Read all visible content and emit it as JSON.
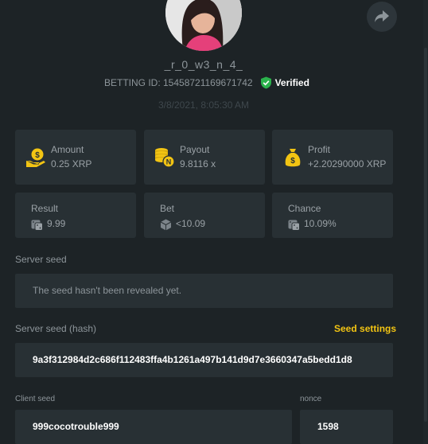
{
  "profile": {
    "username": "_r_0_w3_n_4_",
    "betting_id_label": "BETTING ID: 15458721169671742",
    "verified_label": "Verified",
    "date": "3/8/2021, 8:05:30 AM"
  },
  "stats": [
    {
      "label": "Amount",
      "value": "0.25 XRP",
      "icon": "coin-hand-icon"
    },
    {
      "label": "Payout",
      "value": "9.8116 x",
      "icon": "coin-stack-icon"
    },
    {
      "label": "Profit",
      "value": "+2.20290000 XRP",
      "icon": "money-bag-icon"
    }
  ],
  "details": [
    {
      "label": "Result",
      "value": "9.99",
      "icon": "dice-icon"
    },
    {
      "label": "Bet",
      "value": "<10.09",
      "icon": "cube-icon"
    },
    {
      "label": "Chance",
      "value": "10.09%",
      "icon": "dice-icon"
    }
  ],
  "server_seed": {
    "label": "Server seed",
    "value": "The seed hasn't been revealed yet."
  },
  "server_seed_hash": {
    "label": "Server seed (hash)",
    "settings_label": "Seed settings",
    "value": "9a3f312984d2c686f112483ffa4b1261a497b141d9d7e3660347a5bedd1d8"
  },
  "client_seed": {
    "label": "Client seed",
    "value": "999cocotrouble999"
  },
  "nonce": {
    "label": "nonce",
    "value": "1598"
  },
  "colors": {
    "background": "#1d2326",
    "card": "#283034",
    "accent": "#f2c413",
    "verified_green": "#2bb24c"
  }
}
